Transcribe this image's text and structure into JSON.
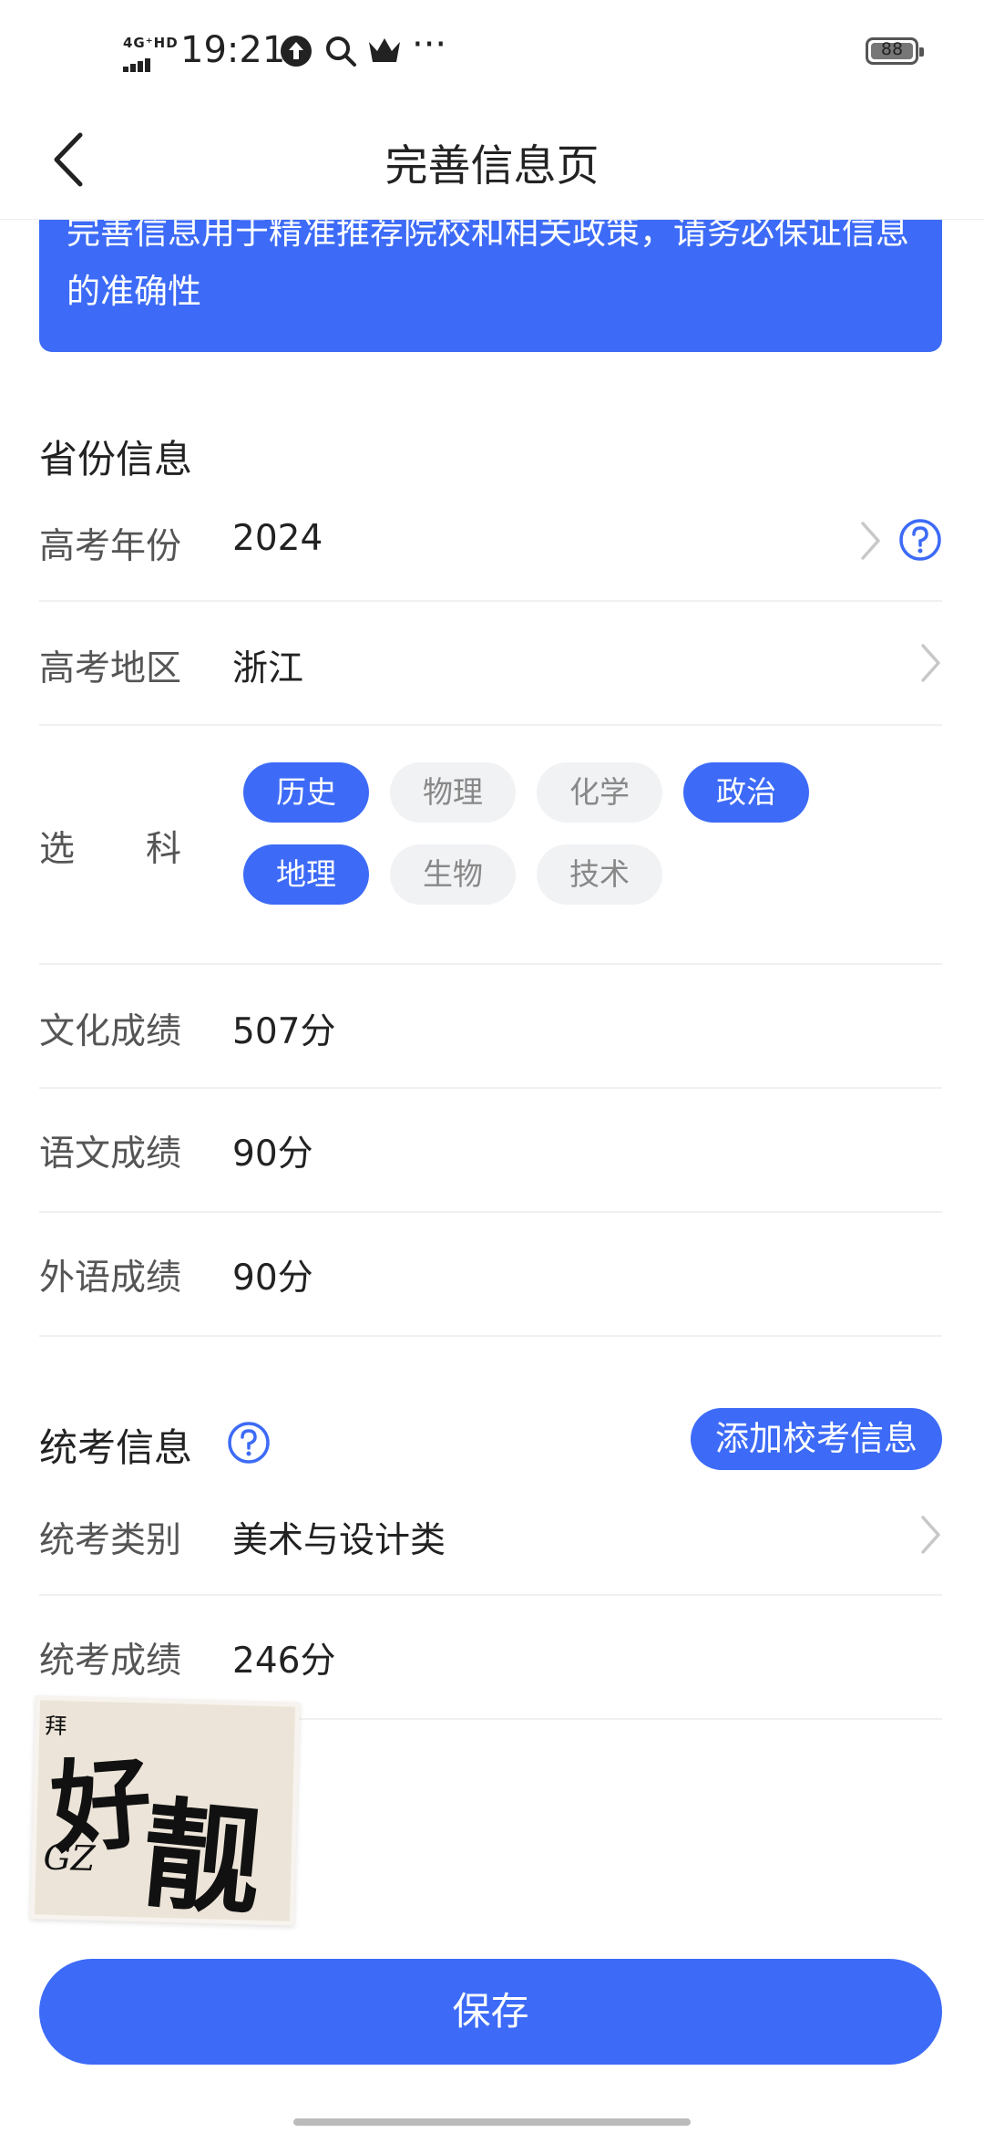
{
  "status_bar": {
    "network": "4G⁺HD",
    "time": "19:21",
    "battery": "88",
    "more": "···"
  },
  "header": {
    "title": "完善信息页"
  },
  "banner": {
    "text": "完善信息用于精准推荐院校和相关政策，请务必保证信息的准确性"
  },
  "province_section": {
    "title": "省份信息",
    "rows": {
      "year": {
        "label": "高考年份",
        "value": "2024"
      },
      "region": {
        "label": "高考地区",
        "value": "浙江"
      },
      "subjects_label": "选　　科",
      "culture": {
        "label": "文化成绩",
        "value": "507分"
      },
      "chinese": {
        "label": "语文成绩",
        "value": "90分"
      },
      "foreign": {
        "label": "外语成绩",
        "value": "90分"
      }
    },
    "subjects": [
      {
        "name": "历史",
        "selected": true
      },
      {
        "name": "物理",
        "selected": false
      },
      {
        "name": "化学",
        "selected": false
      },
      {
        "name": "政治",
        "selected": true
      },
      {
        "name": "地理",
        "selected": true
      },
      {
        "name": "生物",
        "selected": false
      },
      {
        "name": "技术",
        "selected": false
      }
    ]
  },
  "unified_section": {
    "title": "统考信息",
    "add_button": "添加校考信息",
    "category": {
      "label": "统考类别",
      "value": "美术与设计类"
    },
    "score": {
      "label": "统考成绩",
      "value": "246分"
    }
  },
  "sticker": {
    "partial_label": "拜",
    "line1": "好",
    "line2": "靓",
    "mark": "GZ"
  },
  "save_button": "保存",
  "colors": {
    "accent": "#3d6bf7",
    "tag_inactive_bg": "#f1f2f4",
    "label_text": "#555555"
  }
}
